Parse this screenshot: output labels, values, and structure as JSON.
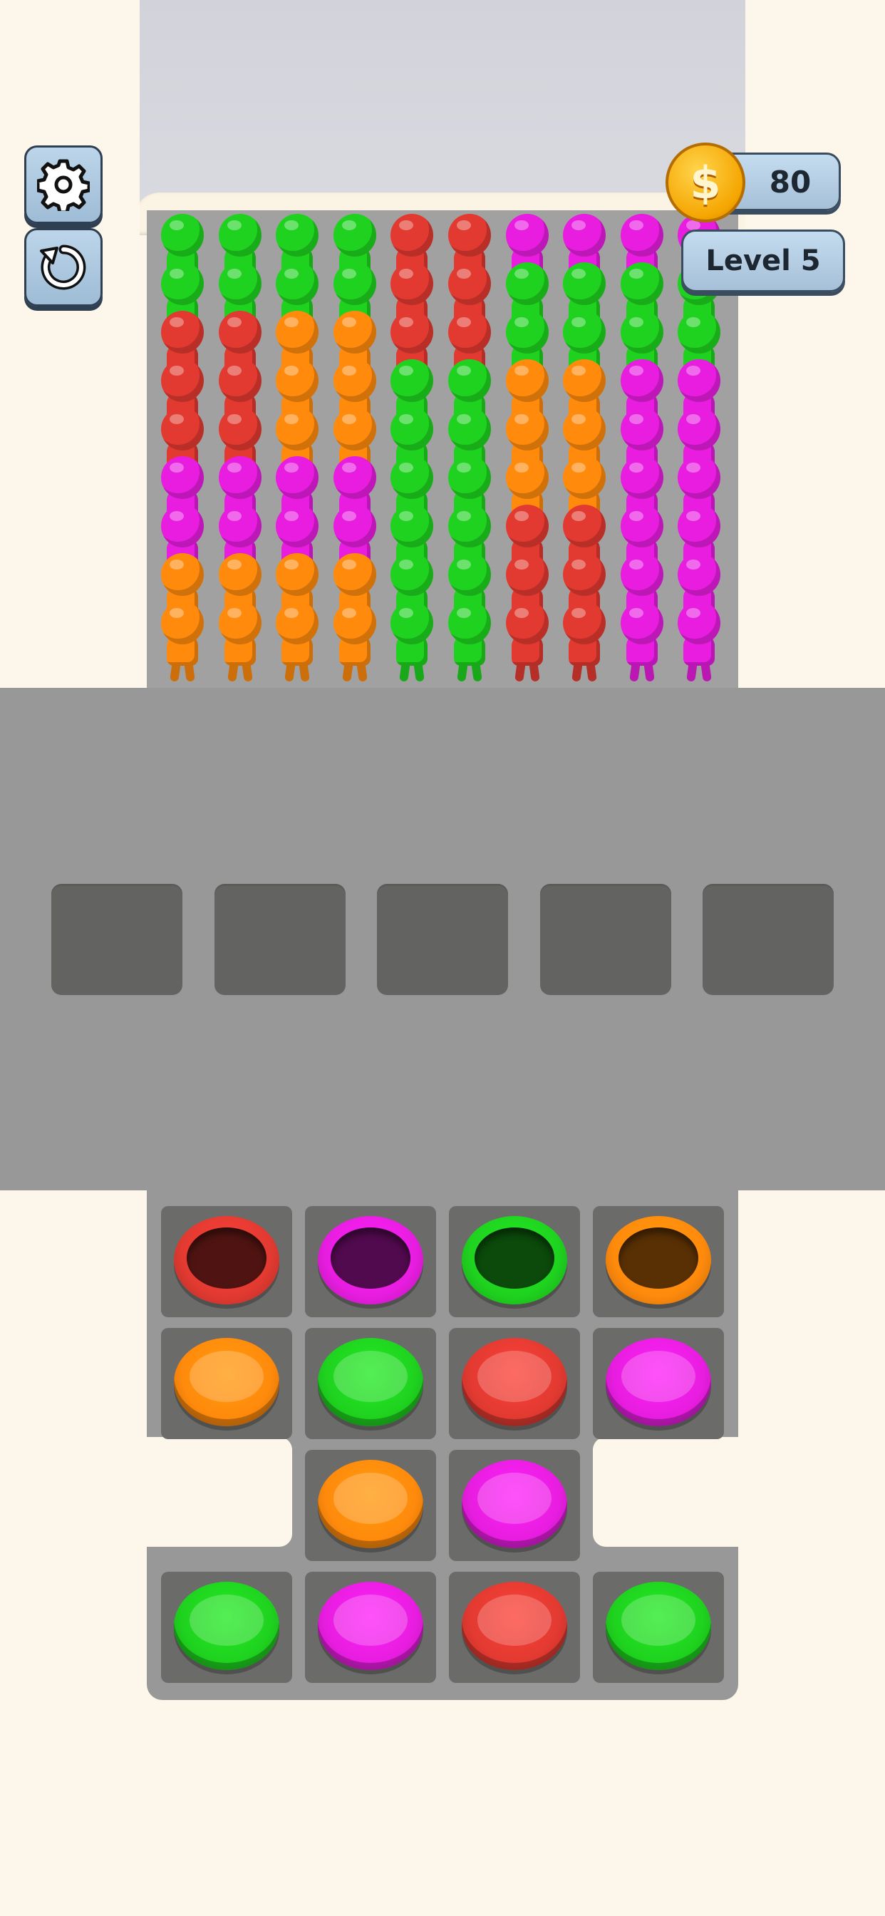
{
  "hud": {
    "coins": "80",
    "coin_symbol": "$",
    "level": "Level 5",
    "settings_icon": "gear-icon",
    "restart_icon": "restart-icon"
  },
  "colors": {
    "green": "#1fd21f",
    "red": "#e23a31",
    "orange": "#ff8a0c",
    "magenta": "#e81de0"
  },
  "crowd_columns": [
    [
      "green",
      "green",
      "red",
      "red",
      "red",
      "magenta",
      "magenta",
      "orange",
      "orange"
    ],
    [
      "green",
      "green",
      "red",
      "red",
      "red",
      "magenta",
      "magenta",
      "orange",
      "orange"
    ],
    [
      "green",
      "green",
      "orange",
      "orange",
      "orange",
      "magenta",
      "magenta",
      "orange",
      "orange"
    ],
    [
      "green",
      "green",
      "orange",
      "orange",
      "orange",
      "magenta",
      "magenta",
      "orange",
      "orange"
    ],
    [
      "red",
      "red",
      "red",
      "green",
      "green",
      "green",
      "green",
      "green",
      "green"
    ],
    [
      "red",
      "red",
      "red",
      "green",
      "green",
      "green",
      "green",
      "green",
      "green"
    ],
    [
      "magenta",
      "green",
      "green",
      "orange",
      "orange",
      "orange",
      "red",
      "red",
      "red"
    ],
    [
      "magenta",
      "green",
      "green",
      "orange",
      "orange",
      "orange",
      "red",
      "red",
      "red"
    ],
    [
      "magenta",
      "green",
      "green",
      "magenta",
      "magenta",
      "magenta",
      "magenta",
      "magenta",
      "magenta"
    ],
    [
      "magenta",
      "green",
      "green",
      "magenta",
      "magenta",
      "magenta",
      "magenta",
      "magenta",
      "magenta"
    ]
  ],
  "queue_slots": 5,
  "board": [
    {
      "row": 0,
      "col": 0,
      "color": "red",
      "kind": "ring"
    },
    {
      "row": 0,
      "col": 1,
      "color": "magenta",
      "kind": "ring"
    },
    {
      "row": 0,
      "col": 2,
      "color": "green",
      "kind": "ring"
    },
    {
      "row": 0,
      "col": 3,
      "color": "orange",
      "kind": "ring"
    },
    {
      "row": 1,
      "col": 0,
      "color": "orange",
      "kind": "solid"
    },
    {
      "row": 1,
      "col": 1,
      "color": "green",
      "kind": "solid"
    },
    {
      "row": 1,
      "col": 2,
      "color": "red",
      "kind": "solid"
    },
    {
      "row": 1,
      "col": 3,
      "color": "magenta",
      "kind": "solid"
    },
    {
      "row": 2,
      "col": 1,
      "color": "orange",
      "kind": "solid"
    },
    {
      "row": 2,
      "col": 2,
      "color": "magenta",
      "kind": "solid"
    },
    {
      "row": 3,
      "col": 0,
      "color": "green",
      "kind": "solid"
    },
    {
      "row": 3,
      "col": 1,
      "color": "magenta",
      "kind": "solid"
    },
    {
      "row": 3,
      "col": 2,
      "color": "red",
      "kind": "solid"
    },
    {
      "row": 3,
      "col": 3,
      "color": "green",
      "kind": "solid"
    }
  ]
}
